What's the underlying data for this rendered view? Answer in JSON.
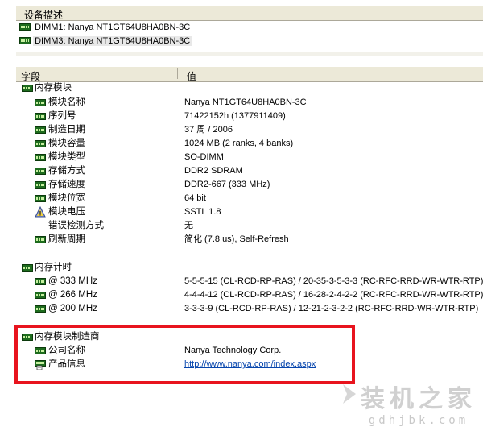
{
  "device_panel": {
    "header": "设备描述",
    "items": [
      {
        "label": "DIMM1: Nanya NT1GT64U8HA0BN-3C",
        "selected": false
      },
      {
        "label": "DIMM3: Nanya NT1GT64U8HA0BN-3C",
        "selected": true
      }
    ]
  },
  "columns": {
    "field": "字段",
    "value": "值"
  },
  "groups": [
    {
      "title": "内存模块",
      "rows": [
        {
          "field": "模块名称",
          "value": "Nanya NT1GT64U8HA0BN-3C",
          "icon": "ram-module-icon"
        },
        {
          "field": "序列号",
          "value": "71422152h (1377911409)",
          "icon": "ram-module-icon"
        },
        {
          "field": "制造日期",
          "value": "37 周 / 2006",
          "icon": "ram-module-icon"
        },
        {
          "field": "模块容量",
          "value": "1024 MB (2 ranks, 4 banks)",
          "icon": "ram-module-icon"
        },
        {
          "field": "模块类型",
          "value": "SO-DIMM",
          "icon": "ram-module-icon"
        },
        {
          "field": "存储方式",
          "value": "DDR2 SDRAM",
          "icon": "ram-module-icon"
        },
        {
          "field": "存储速度",
          "value": "DDR2-667 (333 MHz)",
          "icon": "ram-module-icon"
        },
        {
          "field": "模块位宽",
          "value": "64 bit",
          "icon": "ram-module-icon"
        },
        {
          "field": "模块电压",
          "value": "SSTL 1.8",
          "icon": "voltage-warning-icon"
        },
        {
          "field": "错误检测方式",
          "value": "无",
          "icon": "none"
        },
        {
          "field": "刷新周期",
          "value": "简化 (7.8 us), Self-Refresh",
          "icon": "ram-module-icon"
        }
      ]
    },
    {
      "title": "内存计时",
      "rows": [
        {
          "field": "@ 333 MHz",
          "value": "5-5-5-15  (CL-RCD-RP-RAS) / 20-35-3-5-3-3  (RC-RFC-RRD-WR-WTR-RTP)",
          "icon": "ram-module-icon"
        },
        {
          "field": "@ 266 MHz",
          "value": "4-4-4-12  (CL-RCD-RP-RAS) / 16-28-2-4-2-2  (RC-RFC-RRD-WR-WTR-RTP)",
          "icon": "ram-module-icon"
        },
        {
          "field": "@ 200 MHz",
          "value": "3-3-3-9  (CL-RCD-RP-RAS) / 12-21-2-3-2-2  (RC-RFC-RRD-WR-WTR-RTP)",
          "icon": "ram-module-icon"
        }
      ]
    },
    {
      "title": "内存模块制造商",
      "rows": [
        {
          "field": "公司名称",
          "value": "Nanya Technology Corp.",
          "icon": "ram-module-icon"
        },
        {
          "field": "产品信息",
          "value": "http://www.nanya.com/index.aspx",
          "icon": "product-info-icon",
          "link": true
        }
      ]
    }
  ],
  "watermark": {
    "main": "装机之家",
    "sub": "gdhjbk.com"
  },
  "colors": {
    "ram_icon": "#1e6c1e",
    "highlight_box": "#e8141e",
    "link": "#0645ad"
  }
}
